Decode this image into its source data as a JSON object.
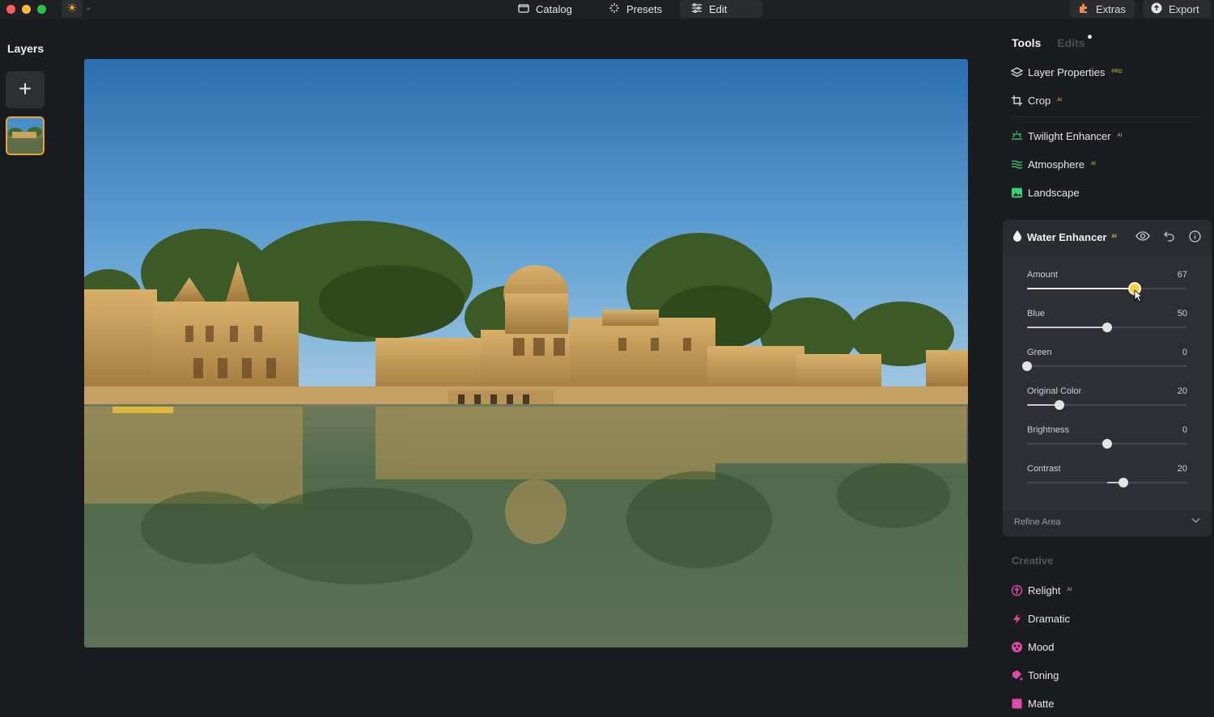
{
  "topbar": {
    "nav": [
      {
        "label": "Catalog",
        "icon": "folder-icon"
      },
      {
        "label": "Presets",
        "icon": "sparkle-icon"
      },
      {
        "label": "Edit",
        "icon": "sliders-icon"
      }
    ],
    "extras_label": "Extras",
    "export_label": "Export"
  },
  "layers": {
    "title": "Layers",
    "add_symbol": "+"
  },
  "panel": {
    "tabs": {
      "tools": "Tools",
      "edits": "Edits"
    },
    "tools": [
      {
        "label": "Layer Properties",
        "badge": "PRO",
        "icon": "layers-icon",
        "color": "#d8d8dc"
      },
      {
        "label": "Crop",
        "badge": "AI",
        "icon": "crop-icon",
        "color": "#d8d8dc"
      },
      {
        "label": "Twilight Enhancer",
        "badge": "AI",
        "icon": "sun-horizon-icon",
        "color": "#3ad07a"
      },
      {
        "label": "Atmosphere",
        "badge": "AI",
        "icon": "waves-icon",
        "color": "#3ad07a"
      },
      {
        "label": "Landscape",
        "badge": "",
        "icon": "landscape-icon",
        "color": "#3ad07a"
      }
    ],
    "water_enhancer": {
      "title": "Water Enhancer",
      "badge": "AI",
      "sliders": [
        {
          "label": "Amount",
          "value": 67,
          "min": 0,
          "max": 100,
          "active": true
        },
        {
          "label": "Blue",
          "value": 50,
          "min": 0,
          "max": 100
        },
        {
          "label": "Green",
          "value": 0,
          "min": 0,
          "max": 100
        },
        {
          "label": "Original Color",
          "value": 20,
          "min": 0,
          "max": 100
        },
        {
          "label": "Brightness",
          "value": 0,
          "min": -100,
          "max": 100
        },
        {
          "label": "Contrast",
          "value": 20,
          "min": -100,
          "max": 100
        }
      ],
      "refine_label": "Refine Area"
    },
    "creative": {
      "title": "Creative",
      "tools": [
        {
          "label": "Relight",
          "badge": "AI",
          "icon": "relight-icon",
          "color": "#e04aa8"
        },
        {
          "label": "Dramatic",
          "badge": "",
          "icon": "bolt-icon",
          "color": "#e04aa8"
        },
        {
          "label": "Mood",
          "badge": "",
          "icon": "mood-icon",
          "color": "#e04aa8"
        },
        {
          "label": "Toning",
          "badge": "",
          "icon": "toning-icon",
          "color": "#e04aa8"
        },
        {
          "label": "Matte",
          "badge": "",
          "icon": "matte-icon",
          "color": "#e04aa8"
        }
      ]
    }
  }
}
